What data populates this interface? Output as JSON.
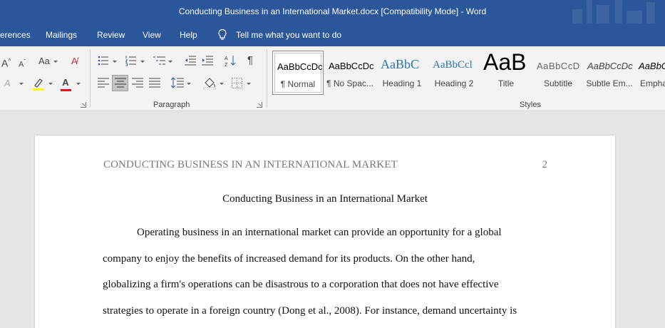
{
  "window": {
    "title": "Conducting Business in an International Market.docx [Compatibility Mode]  -  Word"
  },
  "tabs": {
    "references": "erences",
    "mailings": "Mailings",
    "review": "Review",
    "view": "View",
    "help": "Help",
    "tell_me": "Tell me what you want to do"
  },
  "ribbon": {
    "font_group": {
      "grow_font": "A",
      "shrink_font": "A",
      "change_case": "Aa",
      "text_effects": "A",
      "font_color": "A"
    },
    "paragraph_label": "Paragraph",
    "styles_label": "Styles",
    "styles": [
      {
        "sample": "AaBbCcDc",
        "name": "¶ Normal"
      },
      {
        "sample": "AaBbCcDc",
        "name": "¶ No Spac..."
      },
      {
        "sample": "AaBbC",
        "name": "Heading 1"
      },
      {
        "sample": "AaBbCcl",
        "name": "Heading 2"
      },
      {
        "sample": "AaB",
        "name": "Title"
      },
      {
        "sample": "AaBbCcD",
        "name": "Subtitle"
      },
      {
        "sample": "AaBbCcDc",
        "name": "Subtle Em..."
      },
      {
        "sample": "AaBbCc",
        "name": "Empha"
      }
    ],
    "colors": {
      "highlight": "#ffff00",
      "font_color": "#e81123"
    }
  },
  "document": {
    "header": "CONDUCTING BUSINESS IN AN INTERNATIONAL MARKET",
    "page_number": "2",
    "title": "Conducting Business in an International Market",
    "paragraph_lines": [
      "Operating business in an international market can provide an opportunity for a global",
      "company to enjoy the benefits of increased demand for its products. On the other hand,",
      "globalizing a firm's operations can be disastrous to a corporation that does not have effective",
      "strategies to operate in a foreign country (Dong et al., 2008). For instance, demand uncertainty is"
    ]
  }
}
